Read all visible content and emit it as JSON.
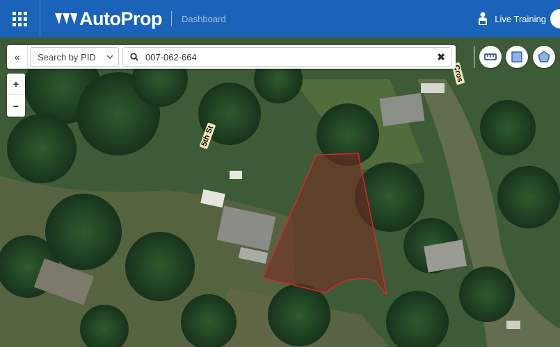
{
  "header": {
    "app_name": "AutoProp",
    "section_label": "Dashboard",
    "live_training_label": "Live Training"
  },
  "search": {
    "collapse_label": "«",
    "mode_label": "Search by PID",
    "query": "007-062-664",
    "clear_label": "✖"
  },
  "zoom": {
    "in_label": "+",
    "out_label": "−"
  },
  "map": {
    "road_labels": [
      "5th St",
      "Cros"
    ],
    "parcel_outline_color": "#d7262e"
  },
  "tools": {
    "icons": [
      "measure-icon",
      "rectangle-icon",
      "polygon-icon"
    ]
  },
  "colors": {
    "header_bg": "#1a63b8",
    "accent_light": "#9ec0ea"
  }
}
